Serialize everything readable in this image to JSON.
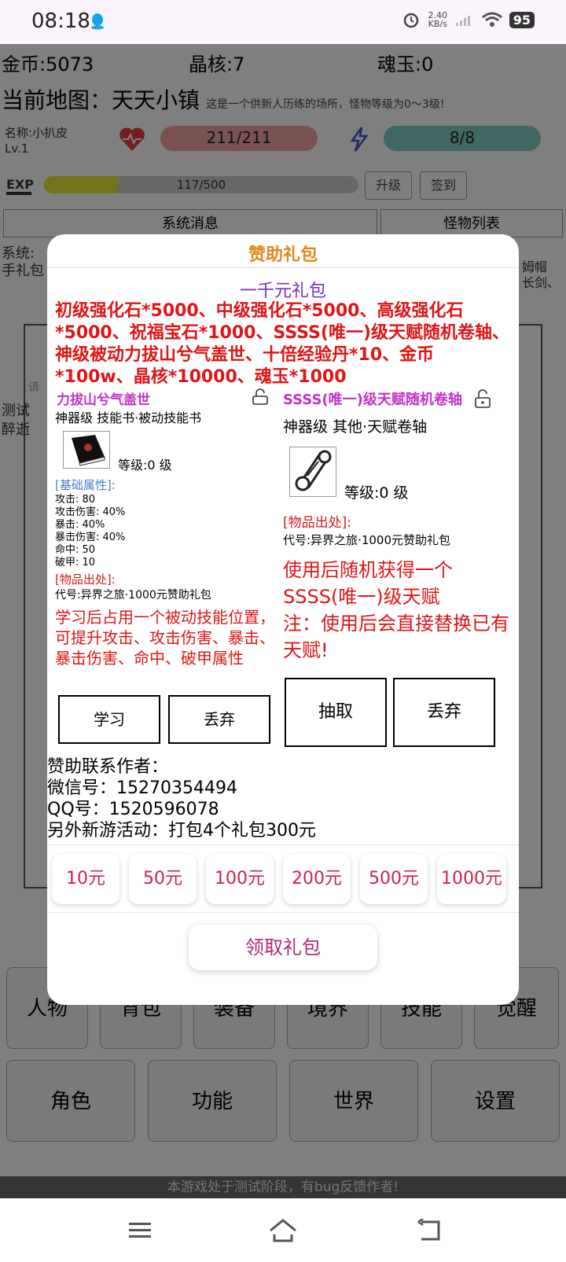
{
  "status": {
    "time": "08:18",
    "net_speed_value": "2.40",
    "net_speed_unit": "KB/s",
    "battery": "95"
  },
  "game": {
    "gold": "金币:5073",
    "crystal": "晶核:7",
    "soul_jade": "魂玉:0",
    "map_label": "当前地图：天天小镇",
    "map_desc": "这是一个供新人历练的场所，怪物等级为0～3级!",
    "char_name": "名称:小扒皮",
    "char_level": "Lv.1",
    "hp": "211/211",
    "mp": "8/8",
    "exp": "117/500",
    "exp_fraction": 0.234,
    "upgrade_btn": "升级",
    "signin_btn": "签到",
    "tab_system": "系统消息",
    "tab_monsters": "怪物列表",
    "system_prefix": "系统:",
    "system_prefix2": "手礼包",
    "right_frag1": "姆帽",
    "right_frag2": "长剑、",
    "left_frag1": "测试",
    "left_frag2": "醉逝",
    "input_frag": "请",
    "footer_notice": "本游戏处于测试阶段，有bug反馈作者!",
    "nav_row1": [
      "人物",
      "背包",
      "装备",
      "境界",
      "技能",
      "觉醒"
    ],
    "nav_row2": [
      "角色",
      "功能",
      "世界",
      "设置"
    ]
  },
  "dialog": {
    "title": "赞助礼包",
    "package_title": "一千元礼包",
    "package_content": "初级强化石*5000、中级强化石*5000、高级强化石*5000、祝福宝石*1000、SSSS(唯一)级天赋随机卷轴、神级被动力拔山兮气盖世、十倍经验丹*10、金币*100w、晶核*10000、魂玉*1000",
    "item1": {
      "name": "力拔山兮气盖世",
      "type": "神器级  技能书·被动技能书",
      "level": "等级:0 级",
      "attr_header": "[基础属性]:",
      "attrs": [
        "攻击: 80",
        "攻击伤害: 40%",
        "暴击: 40%",
        "暴击伤害: 40%",
        "命中: 50",
        "破甲: 10"
      ],
      "source_header": "[物品出处]:",
      "source": "代号:异界之旅·1000元赞助礼包",
      "desc": "学习后占用一个被动技能位置，可提升攻击、攻击伤害、暴击、暴击伤害、命中、破甲属性",
      "btn_primary": "学习",
      "btn_discard": "丢弃"
    },
    "item2": {
      "name": "SSSS(唯一)级天赋随机卷轴",
      "type": "神器级  其他·天赋卷轴",
      "level": "等级:0 级",
      "source_header": "[物品出处]:",
      "source": "代号:异界之旅·1000元赞助礼包",
      "desc": "使用后随机获得一个SSSS(唯一)级天赋\n注：使用后会直接替换已有天赋!",
      "btn_primary": "抽取",
      "btn_discard": "丢弃"
    },
    "contact": [
      "赞助联系作者：",
      "微信号：15270354494",
      "QQ号：1520596078",
      "另外新游活动：打包4个礼包300元"
    ],
    "amounts": [
      "10元",
      "50元",
      "100元",
      "200元",
      "500元",
      "1000元"
    ],
    "claim_btn": "领取礼包"
  }
}
